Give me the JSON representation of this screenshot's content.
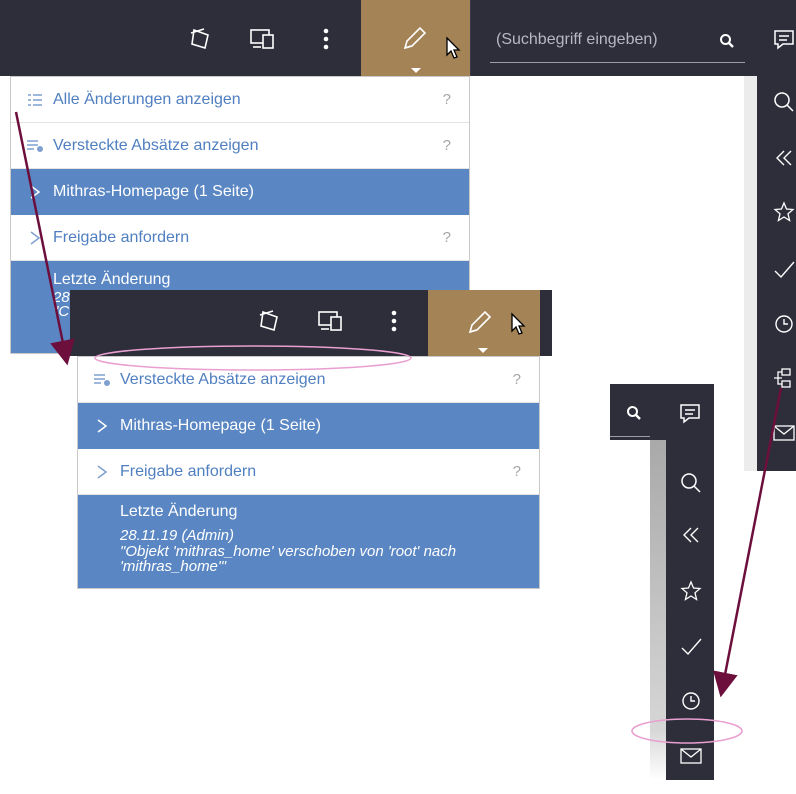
{
  "toolbar": {
    "search_placeholder": "(Suchbegriff eingeben)"
  },
  "menu_top": {
    "items": [
      {
        "label": "Alle Änderungen anzeigen",
        "help": "?"
      },
      {
        "label": "Versteckte Absätze anzeigen",
        "help": "?"
      },
      {
        "label": "Mithras-Homepage (1 Seite)"
      },
      {
        "label": "Freigabe anfordern",
        "help": "?"
      },
      {
        "label": "Letzte Änderung",
        "partial_line1": "28",
        "partial_line2": "\"C"
      }
    ]
  },
  "menu_zoom": {
    "items": [
      {
        "label": "Versteckte Absätze anzeigen",
        "help": "?"
      },
      {
        "label": "Mithras-Homepage (1 Seite)"
      },
      {
        "label": "Freigabe anfordern",
        "help": "?"
      }
    ],
    "last_change": {
      "title": "Letzte Änderung",
      "date_user": "28.11.19 (Admin)",
      "message": "\"Objekt 'mithras_home' verschoben von 'root' nach 'mithras_home'\""
    }
  },
  "colors": {
    "toolbar_bg": "#2e2d3a",
    "pencil_bg": "#a48357",
    "menu_blue": "#5a87c3",
    "menu_text": "#4f7fc0",
    "arrow": "#6d0f3c",
    "highlight_ellipse": "#e99fd0"
  },
  "icons": [
    "preview-icon",
    "devices-icon",
    "more-vertical-icon",
    "pencil-icon",
    "cursor-icon",
    "search-icon",
    "comment-icon",
    "zoom-icon",
    "chevrons-left-icon",
    "star-icon",
    "check-icon",
    "clock-icon",
    "structure-icon",
    "mail-icon"
  ]
}
